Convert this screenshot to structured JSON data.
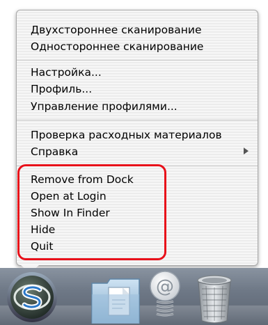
{
  "menu": {
    "group1": [
      {
        "label": "Двухстороннее сканирование"
      },
      {
        "label": "Одностороннее сканирование"
      }
    ],
    "group2": [
      {
        "label": "Настройка..."
      },
      {
        "label": "Профиль..."
      },
      {
        "label": "Управление профилями..."
      }
    ],
    "group3": [
      {
        "label": "Проверка расходных материалов"
      },
      {
        "label": "Справка",
        "submenu_icon": "triangle-right-icon"
      }
    ],
    "group4": [
      {
        "label": "Remove from Dock"
      },
      {
        "label": "Open at Login"
      },
      {
        "label": "Show In Finder"
      },
      {
        "label": "Hide"
      },
      {
        "label": "Quit"
      }
    ],
    "highlight_color": "#e8101a"
  },
  "dock": {
    "items": [
      {
        "icon": "scansnap-manager-icon"
      },
      {
        "icon": "documents-folder-icon"
      },
      {
        "icon": "mail-spring-icon"
      },
      {
        "icon": "trash-icon"
      }
    ]
  }
}
